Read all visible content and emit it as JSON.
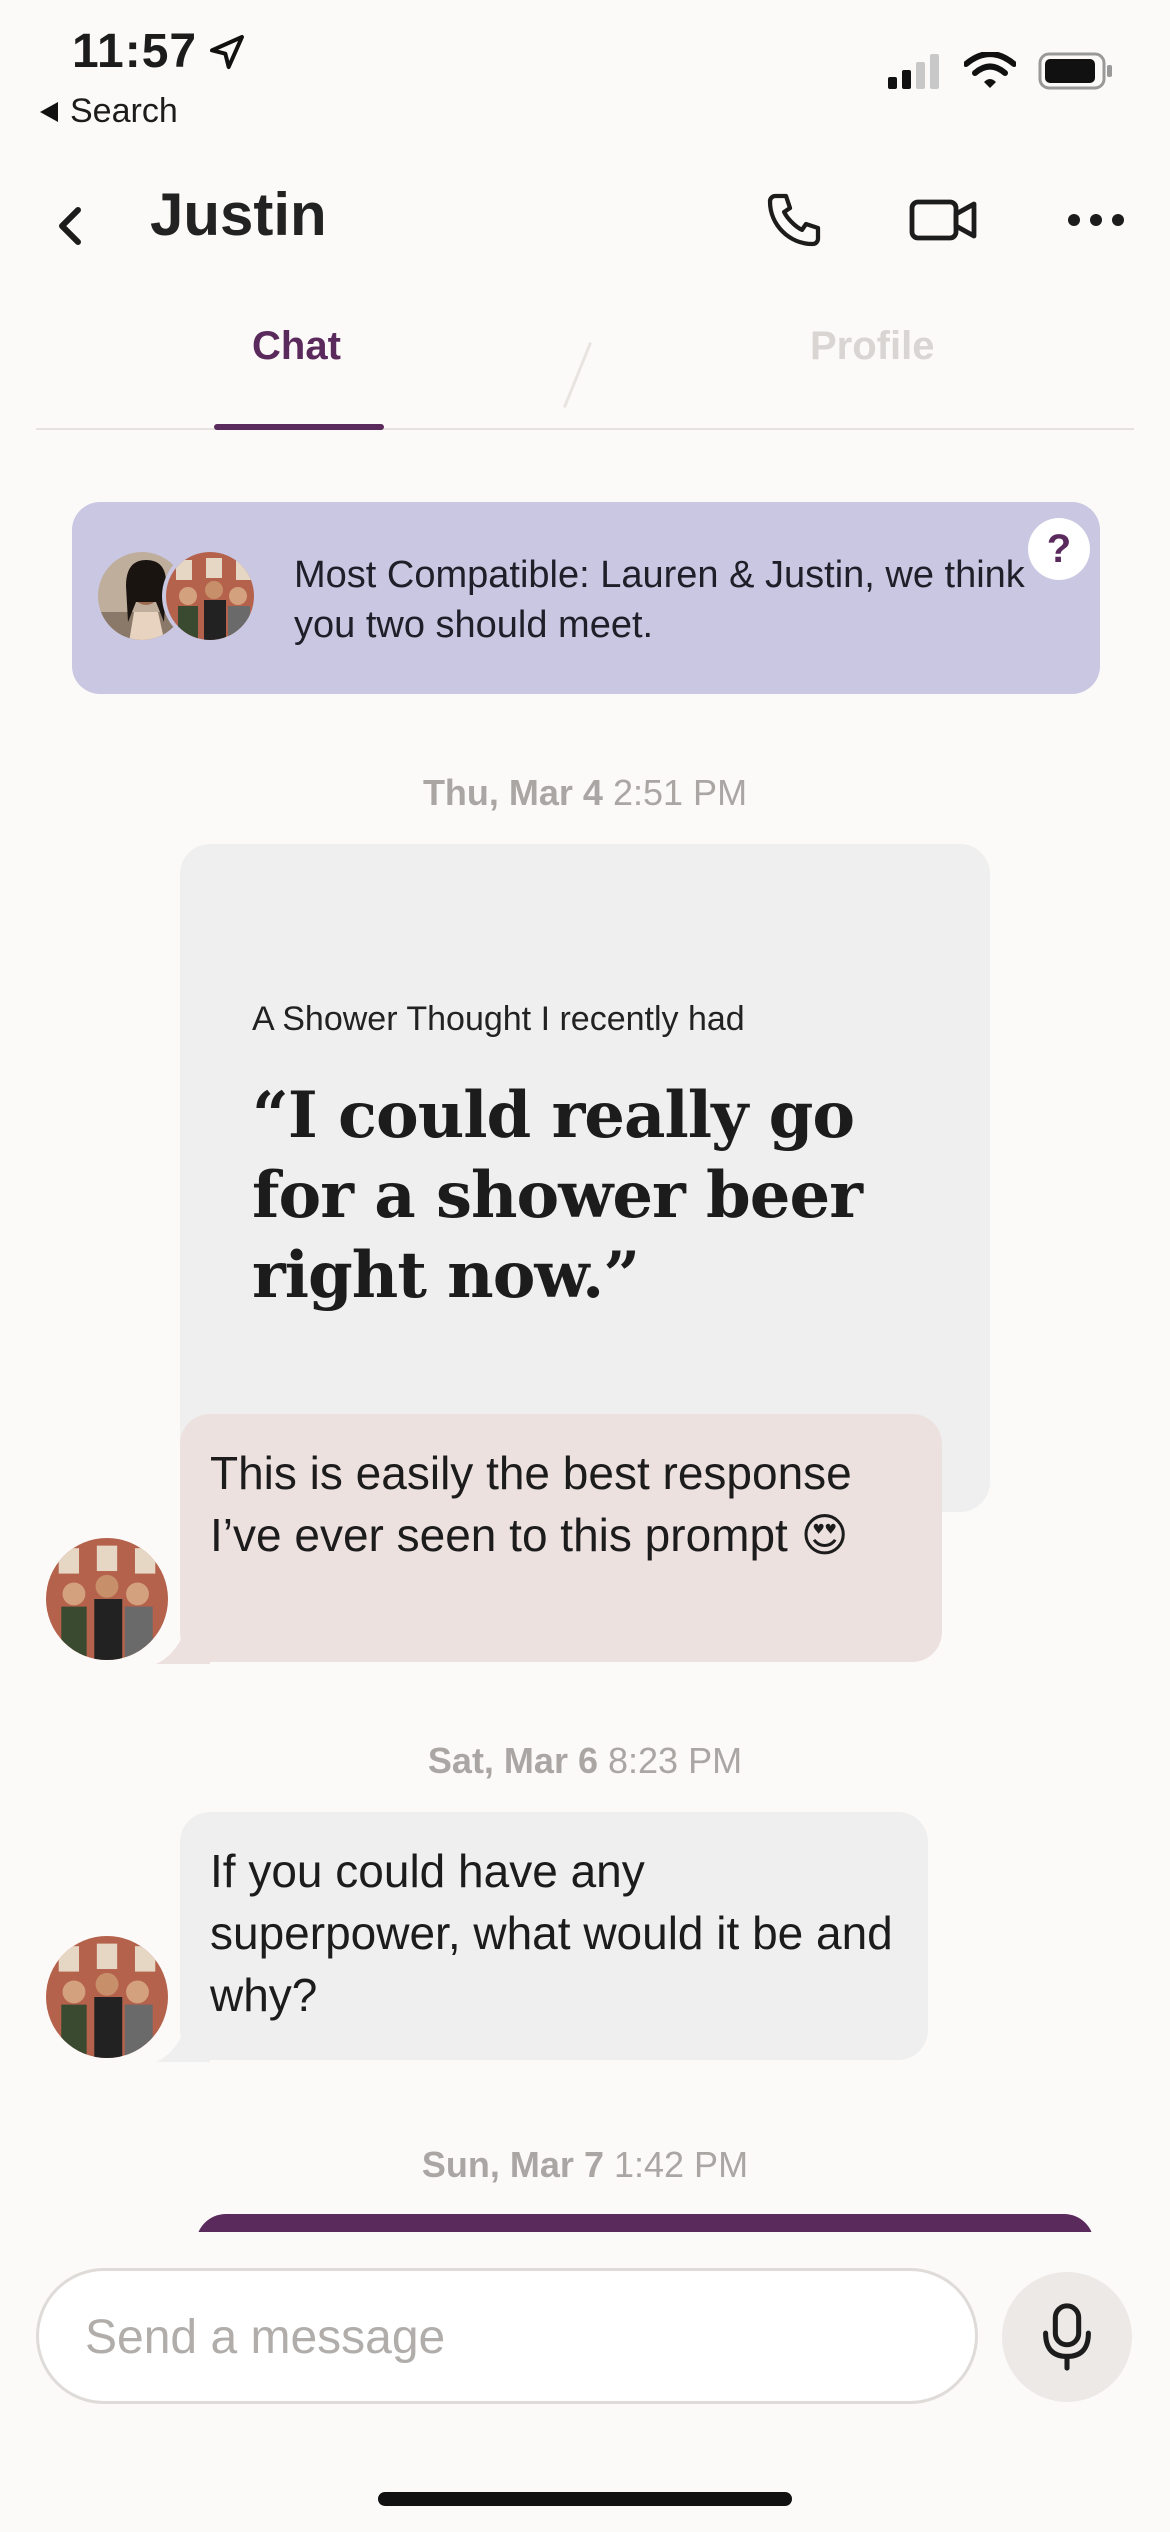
{
  "status_bar": {
    "time": "11:57",
    "back_label": "Search",
    "icons": [
      "location-arrow-icon",
      "signal-icon",
      "wifi-icon",
      "battery-icon"
    ]
  },
  "header": {
    "title": "Justin",
    "icons": [
      "back-chevron-icon",
      "phone-icon",
      "video-camera-icon",
      "more-dots-icon"
    ]
  },
  "tabs": [
    {
      "label": "Chat",
      "active": true
    },
    {
      "label": "Profile",
      "active": false
    }
  ],
  "banner": {
    "text": "Most Compatible: Lauren & Justin, we think you two should meet.",
    "help_symbol": "?"
  },
  "messages": [
    {
      "stamp_day": "Thu, Mar 4",
      "stamp_time": "2:51 PM",
      "prompt_question": "A Shower Thought I recently had",
      "prompt_answer": "“I could really go for a shower beer right now.”",
      "reply": "This is easily the best response I’ve ever seen to this prompt 😍"
    },
    {
      "stamp_day": "Sat, Mar 6",
      "stamp_time": "8:23 PM",
      "text": "If you could have any superpower, what would it be and why?"
    },
    {
      "stamp_day": "Sun, Mar 7",
      "stamp_time": "1:42 PM"
    }
  ],
  "composer": {
    "placeholder": "Send a message",
    "value": ""
  },
  "colors": {
    "accent": "#5b2a5d",
    "banner_bg": "#c9c7e1",
    "bubble_grey": "#efefef",
    "bubble_pink": "#ede1df"
  }
}
